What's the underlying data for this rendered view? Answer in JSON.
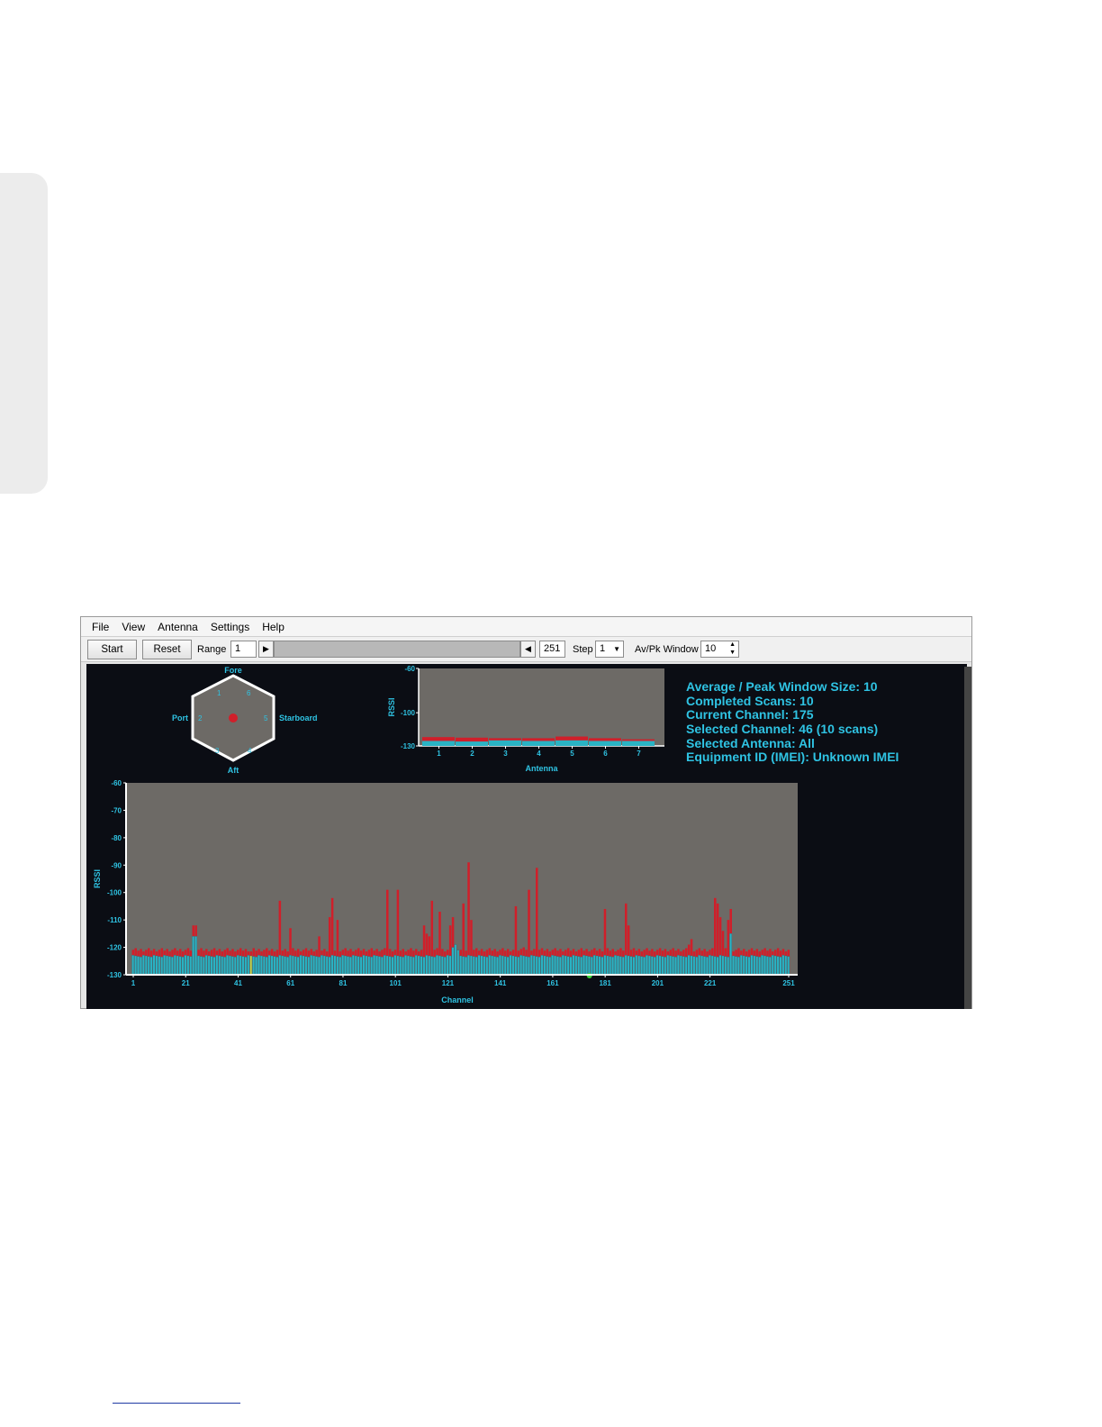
{
  "menu": [
    "File",
    "View",
    "Antenna",
    "Settings",
    "Help"
  ],
  "toolbar": {
    "start_label": "Start",
    "reset_label": "Reset",
    "range_label": "Range",
    "range_start": "1",
    "range_end": "251",
    "step_label": "Step",
    "step_value": "1",
    "avpk_label": "Av/Pk Window",
    "avpk_value": "10"
  },
  "compass": {
    "fore": "Fore",
    "aft": "Aft",
    "port": "Port",
    "starboard": "Starboard",
    "antennas": [
      "1",
      "2",
      "3",
      "4",
      "5",
      "6"
    ]
  },
  "info": {
    "window_size": "Average / Peak Window Size: 10",
    "completed_scans": "Completed Scans: 10",
    "current_channel": "Current Channel: 175",
    "selected_channel": "Selected Channel: 46 (10 scans)",
    "selected_antenna": "Selected Antenna: All",
    "equipment_id": "Equipment ID (IMEI): Unknown IMEI"
  },
  "colors": {
    "plot_bg": "#6d6a66",
    "display_bg": "#0b0d14",
    "axis_text": "#2fc3e3",
    "average": "#2ab3c4",
    "peak": "#d01f2a",
    "highlight": "#c8d74a",
    "current_marker": "#3fd43f"
  },
  "chart_data": [
    {
      "type": "bar",
      "xlabel": "Antenna",
      "ylabel": "RSSI",
      "ylim": [
        -130,
        -60
      ],
      "y_ticks": [
        "-60",
        "-100",
        "-130"
      ],
      "categories": [
        "1",
        "2",
        "3",
        "4",
        "5",
        "6",
        "7"
      ],
      "series": [
        {
          "values": [
            -125.5,
            -126,
            -125,
            -125.5,
            -125,
            -125.5,
            -125.5
          ]
        },
        {
          "values": [
            -122,
            -122.5,
            -123,
            -123,
            -121.5,
            -123,
            -124
          ]
        }
      ]
    },
    {
      "type": "bar",
      "xlabel": "Channel",
      "ylabel": "RSSI",
      "ylim": [
        -130,
        -60
      ],
      "y_ticks": [
        "-60",
        "-70",
        "-80",
        "-90",
        "-100",
        "-110",
        "-120",
        "-130"
      ],
      "x_ticks": [
        "1",
        "21",
        "41",
        "61",
        "81",
        "101",
        "121",
        "141",
        "161",
        "181",
        "201",
        "221",
        "251"
      ],
      "x_range": [
        1,
        251
      ],
      "selected_channel": 46,
      "current_channel": 175,
      "average_baseline": -123.5,
      "peak_baseline": -121.5,
      "average_spikes": [
        [
          24,
          -116
        ],
        [
          25,
          -116
        ],
        [
          123,
          -120
        ],
        [
          124,
          -119
        ],
        [
          125,
          -121
        ],
        [
          229,
          -115
        ]
      ],
      "peak_spikes": [
        [
          24,
          -112
        ],
        [
          25,
          -112
        ],
        [
          46,
          -121.5
        ],
        [
          57,
          -103
        ],
        [
          61,
          -113
        ],
        [
          72,
          -116
        ],
        [
          76,
          -109
        ],
        [
          77,
          -102
        ],
        [
          79,
          -110
        ],
        [
          98,
          -99
        ],
        [
          102,
          -99
        ],
        [
          112,
          -112
        ],
        [
          113,
          -115
        ],
        [
          114,
          -116
        ],
        [
          115,
          -103
        ],
        [
          118,
          -107
        ],
        [
          122,
          -112
        ],
        [
          123,
          -109
        ],
        [
          127,
          -104
        ],
        [
          129,
          -89
        ],
        [
          130,
          -110
        ],
        [
          147,
          -105
        ],
        [
          150,
          -120
        ],
        [
          152,
          -99
        ],
        [
          155,
          -91
        ],
        [
          181,
          -106
        ],
        [
          189,
          -104
        ],
        [
          190,
          -112
        ],
        [
          213,
          -119
        ],
        [
          214,
          -117
        ],
        [
          223,
          -102
        ],
        [
          224,
          -104
        ],
        [
          225,
          -109
        ],
        [
          226,
          -114
        ],
        [
          228,
          -110
        ],
        [
          229,
          -106
        ]
      ]
    }
  ]
}
